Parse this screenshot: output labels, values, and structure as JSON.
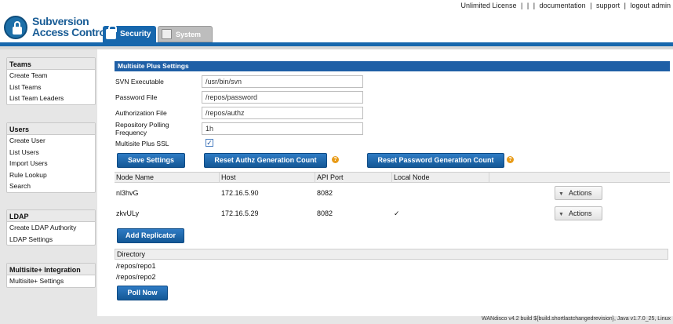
{
  "header": {
    "brand_line1": "Subversion",
    "brand_line2": "Access Control",
    "links": [
      "Unlimited License",
      "|",
      "documentation",
      "support",
      "logout admin"
    ],
    "tabs": [
      {
        "label": "Security",
        "icon": "lock-icon",
        "active": true
      },
      {
        "label": "System",
        "icon": "monitor-icon",
        "active": false
      }
    ],
    "accent_color": "#1767ad"
  },
  "sidebar": {
    "teams": {
      "title": "Teams",
      "items": [
        "Create Team",
        "List Teams",
        "List Team Leaders"
      ]
    },
    "users": {
      "title": "Users",
      "items": [
        "Create User",
        "List Users",
        "Import Users",
        "Rule Lookup",
        "Search"
      ]
    },
    "ldap": {
      "title": "LDAP",
      "items": [
        "Create LDAP Authority",
        "LDAP Settings"
      ]
    },
    "multisite": {
      "title": "Multisite+ Integration",
      "items": [
        "Multisite+ Settings"
      ]
    }
  },
  "panel": {
    "title": "Multisite Plus Settings",
    "fields": [
      {
        "label": "SVN Executable",
        "value": "/usr/bin/svn"
      },
      {
        "label": "Password File",
        "value": "/repos/password"
      },
      {
        "label": "Authorization File",
        "value": "/repos/authz"
      },
      {
        "label": "Repository Polling Frequency",
        "value": "1h"
      }
    ],
    "ssl": {
      "label": "Multisite Plus SSL",
      "checked": true,
      "check_glyph": "✓"
    },
    "buttons": {
      "save": "Save Settings",
      "reset_authz": "Reset Authz Generation Count",
      "reset_password": "Reset Password Generation Count",
      "add_replicator": "Add Replicator",
      "poll_now": "Poll Now",
      "help_glyph": "?"
    },
    "nodes": {
      "columns": [
        "Node Name",
        "Host",
        "API Port",
        "Local Node"
      ],
      "rows": [
        {
          "name": "nl3hvG",
          "host": "172.16.5.90",
          "port": "8082",
          "local": "",
          "action": "Actions"
        },
        {
          "name": "zkvULy",
          "host": "172.16.5.29",
          "port": "8082",
          "local": "✓",
          "action": "Actions"
        }
      ],
      "caret": "▼"
    },
    "directories": {
      "header": "Directory",
      "items": [
        "/repos/repo1",
        "/repos/repo2"
      ]
    }
  },
  "footer": {
    "text": "WANdisco v4.2 build ${build.shortlastchangedrevision}, Java v1.7.0_25, Linux"
  }
}
